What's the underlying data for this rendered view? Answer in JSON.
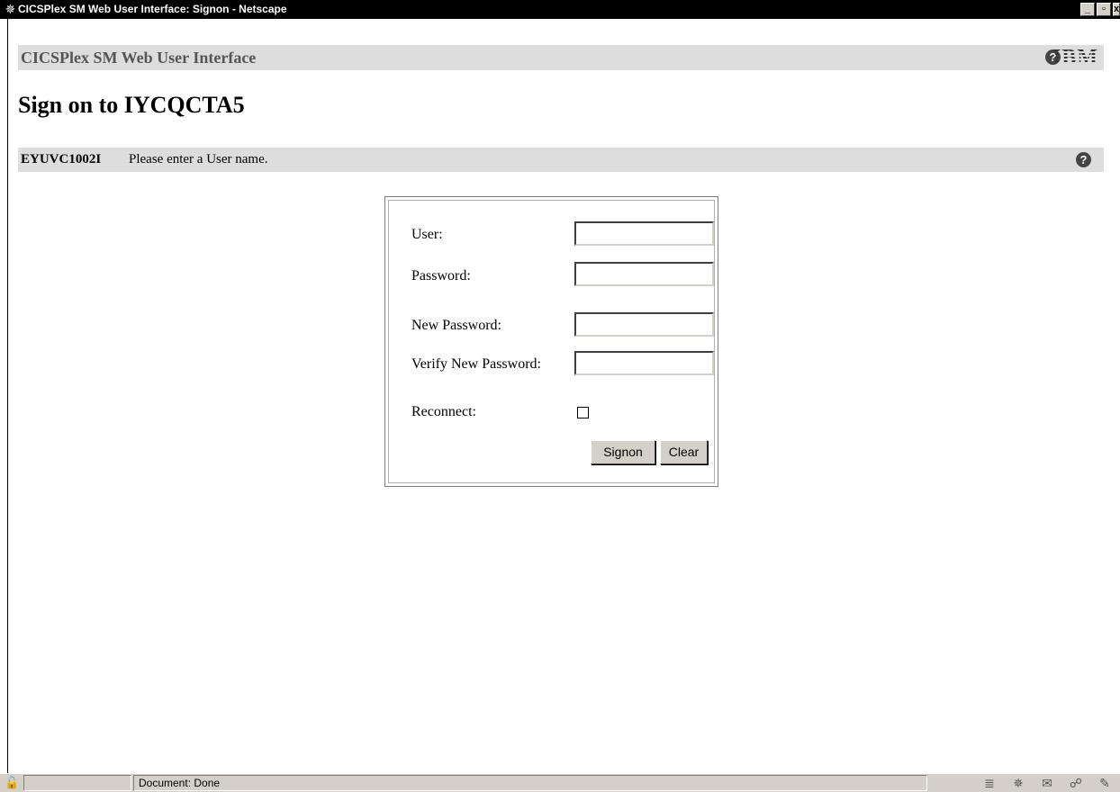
{
  "window": {
    "title": "CICSPlex SM Web User Interface: Signon - Netscape",
    "app_icon": "netscape-icon",
    "buttons": {
      "minimize": "_",
      "maximize": "▫",
      "close": "x"
    }
  },
  "banner": {
    "title": "CICSPlex SM Web User Interface",
    "help_icon": "help-icon",
    "logo_text": "IBM"
  },
  "page": {
    "title": "Sign on to IYCQCTA5"
  },
  "message": {
    "id": "EYUVC1002I",
    "text": "Please enter a User name.",
    "help_icon": "help-icon"
  },
  "form": {
    "user_label": "User:",
    "user_value": "",
    "password_label": "Password:",
    "password_value": "",
    "new_password_label": "New Password:",
    "new_password_value": "",
    "verify_password_label": "Verify New Password:",
    "verify_password_value": "",
    "reconnect_label": "Reconnect:",
    "reconnect_checked": false,
    "signon_label": "Signon",
    "clear_label": "Clear"
  },
  "statusbar": {
    "text": "Document: Done",
    "icons": [
      "security-lock-icon",
      "component-bar-icon",
      "navigator-icon",
      "mail-icon",
      "discussion-icon",
      "composer-icon"
    ]
  }
}
